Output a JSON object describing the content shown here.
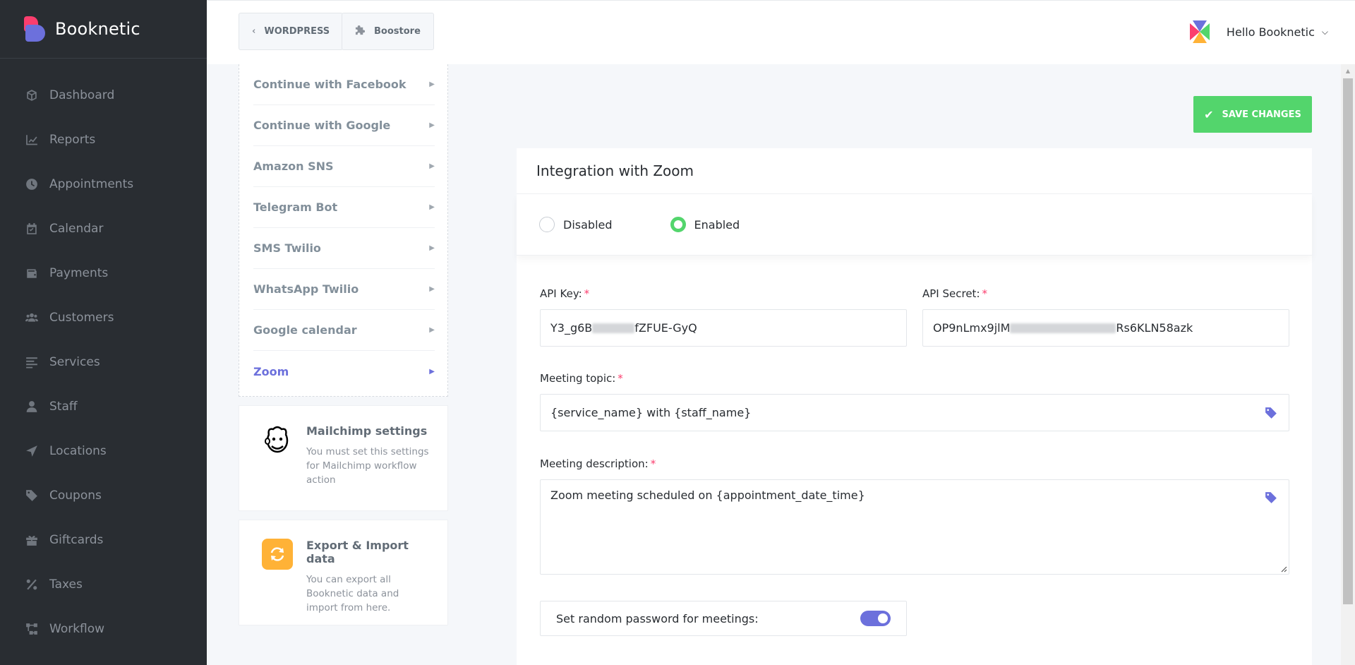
{
  "brand": {
    "name": "Booknetic"
  },
  "sidebar": {
    "items": [
      {
        "label": "Dashboard",
        "icon": "cube-icon"
      },
      {
        "label": "Reports",
        "icon": "chart-line-icon"
      },
      {
        "label": "Appointments",
        "icon": "clock-icon"
      },
      {
        "label": "Calendar",
        "icon": "calendar-icon"
      },
      {
        "label": "Payments",
        "icon": "wallet-icon"
      },
      {
        "label": "Customers",
        "icon": "users-icon"
      },
      {
        "label": "Services",
        "icon": "list-icon"
      },
      {
        "label": "Staff",
        "icon": "user-icon"
      },
      {
        "label": "Locations",
        "icon": "location-arrow-icon"
      },
      {
        "label": "Coupons",
        "icon": "tag-icon"
      },
      {
        "label": "Giftcards",
        "icon": "gift-icon"
      },
      {
        "label": "Taxes",
        "icon": "percent-icon"
      },
      {
        "label": "Workflow",
        "icon": "workflow-icon"
      }
    ]
  },
  "header": {
    "wordpress_label": "WORDPRESS",
    "boostore_label": "Boostore",
    "user_greeting": "Hello Booknetic"
  },
  "settings_menu": {
    "items": [
      {
        "label": "Continue with Facebook",
        "active": false
      },
      {
        "label": "Continue with Google",
        "active": false
      },
      {
        "label": "Amazon SNS",
        "active": false
      },
      {
        "label": "Telegram Bot",
        "active": false
      },
      {
        "label": "SMS Twilio",
        "active": false
      },
      {
        "label": "WhatsApp Twilio",
        "active": false
      },
      {
        "label": "Google calendar",
        "active": false
      },
      {
        "label": "Zoom",
        "active": true
      }
    ],
    "cards": [
      {
        "title": "Mailchimp settings",
        "text": "You must set this settings for Mailchimp workflow action"
      },
      {
        "title": "Export & Import data",
        "text": "You can export all Booknetic data and import from here."
      }
    ]
  },
  "main": {
    "save_label": "SAVE CHANGES",
    "panel_title": "Integration with Zoom",
    "radio_disabled": "Disabled",
    "radio_enabled": "Enabled",
    "selected": "Enabled",
    "api_key_label": "API Key:",
    "api_key_prefix": "Y3_g6B",
    "api_key_suffix": "fZFUE-GyQ",
    "api_secret_label": "API Secret:",
    "api_secret_prefix": "OP9nLmx9jlM",
    "api_secret_suffix": "Rs6KLN58azk",
    "topic_label": "Meeting topic:",
    "topic_value": "{service_name} with {staff_name}",
    "description_label": "Meeting description:",
    "description_value": "Zoom meeting scheduled on {appointment_date_time}",
    "password_label": "Set random password for meetings:",
    "password_enabled": true,
    "required_mark": "*"
  },
  "colors": {
    "sidebar_bg": "#292d32",
    "accent": "#6c70dc",
    "success": "#53d56c",
    "danger": "#fb3e6e"
  }
}
